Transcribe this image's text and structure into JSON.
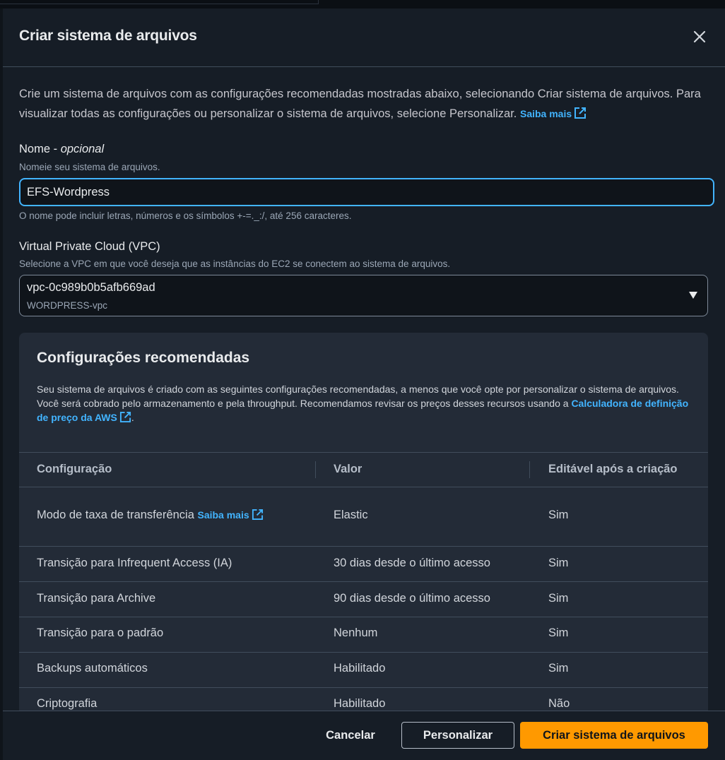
{
  "modal": {
    "title": "Criar sistema de arquivos",
    "intro_text": "Crie um sistema de arquivos com as configurações recomendadas mostradas abaixo, selecionando Criar sistema de arquivos. Para visualizar todas as configurações ou personalizar o sistema de arquivos, selecione Personalizar.",
    "intro_link": "Saiba mais"
  },
  "name_field": {
    "label": "Nome",
    "label_suffix": "opcional",
    "description": "Nomeie seu sistema de arquivos.",
    "value": "EFS-Wordpress",
    "hint": "O nome pode incluir letras, números e os símbolos +-=._:/, até 256 caracteres."
  },
  "vpc_field": {
    "label": "Virtual Private Cloud (VPC)",
    "description": "Selecione a VPC em que você deseja que as instâncias do EC2 se conectem ao sistema de arquivos.",
    "selected_value": "vpc-0c989b0b5afb669ad",
    "selected_sub": "WORDPRESS-vpc"
  },
  "recommended": {
    "title": "Configurações recomendadas",
    "description": "Seu sistema de arquivos é criado com as seguintes configurações recomendadas, a menos que você opte por personalizar o sistema de arquivos. Você será cobrado pelo armazenamento e pela throughput. Recomendamos revisar os preços desses recursos usando a",
    "pricing_link": "Calculadora de definição de preço da AWS",
    "headers": [
      "Configuração",
      "Valor",
      "Editável após a criação"
    ],
    "rows": [
      {
        "config": "Modo de taxa de transferência",
        "link": "Saiba mais",
        "value": "Elastic",
        "editable": "Sim"
      },
      {
        "config": "Transição para Infrequent Access (IA)",
        "value": "30 dias desde o último acesso",
        "editable": "Sim"
      },
      {
        "config": "Transição para Archive",
        "value": "90 dias desde o último acesso",
        "editable": "Sim"
      },
      {
        "config": "Transição para o padrão",
        "value": "Nenhum",
        "editable": "Sim"
      },
      {
        "config": "Backups automáticos",
        "value": "Habilitado",
        "editable": "Sim"
      },
      {
        "config": "Criptografia",
        "value": "Habilitado",
        "editable": "Não"
      }
    ]
  },
  "footer": {
    "cancel_label": "Cancelar",
    "customize_label": "Personalizar",
    "create_label": "Criar sistema de arquivos"
  },
  "colors": {
    "accent_link": "#42b4ff",
    "primary_button": "#ff9900",
    "modal_bg": "#161d26",
    "panel_bg": "#232b37"
  },
  "icons": {
    "close": "close-icon",
    "external_link": "external-link-icon",
    "caret": "caret-down-icon"
  }
}
